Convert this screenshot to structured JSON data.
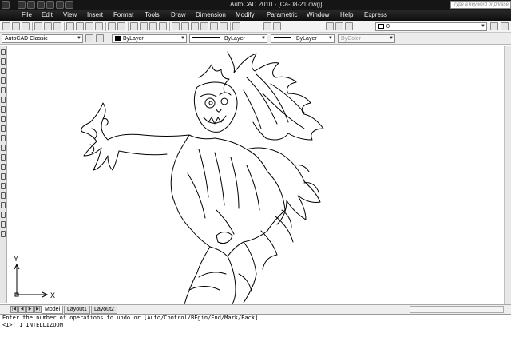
{
  "window": {
    "title": "AutoCAD 2010 - [Ca-08-21.dwg]",
    "search_placeholder": "Type a keyword or phrase"
  },
  "menu": {
    "items": [
      "File",
      "Edit",
      "View",
      "Insert",
      "Format",
      "Tools",
      "Draw",
      "Dimension",
      "Modify",
      "Parametric",
      "Window",
      "Help",
      "Express"
    ]
  },
  "toolbar": {
    "layer_value": "0",
    "workspace": "AutoCAD Classic"
  },
  "properties": {
    "color": "ByLayer",
    "linetype": "ByLayer",
    "lineweight": "ByLayer",
    "plotstyle": "ByColor"
  },
  "ucs": {
    "x_label": "X",
    "y_label": "Y"
  },
  "layout_tabs": [
    "Model",
    "Layout1",
    "Layout2"
  ],
  "command": {
    "line1": "Enter the number of operations to undo or [Auto/Control/BEgin/End/Mark/Back]",
    "line2": "<1>: 1 INTELLIZOOM"
  },
  "colors": {
    "title_bg": "#151515",
    "menu_bg": "#0e0e0e",
    "canvas_bg": "#ffffff"
  }
}
